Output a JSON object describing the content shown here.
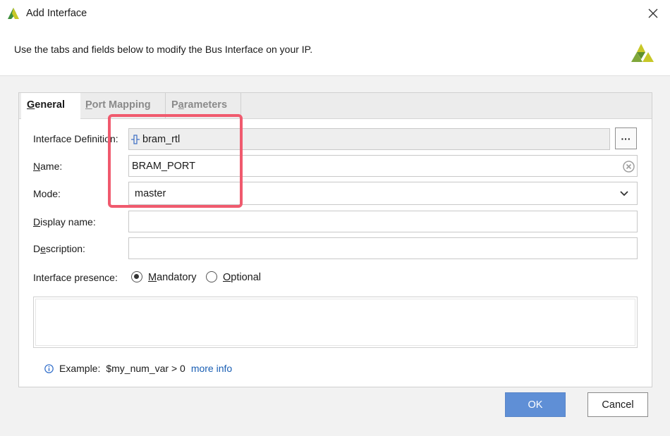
{
  "window": {
    "title": "Add Interface",
    "logo_icon": "vivado-logo-icon",
    "close_icon": "close-icon"
  },
  "header": {
    "description": "Use the tabs and fields below to modify the Bus Interface on your IP.",
    "brand_icon": "xilinx-logo-icon"
  },
  "tabs": [
    {
      "label": "General",
      "accel": "G",
      "rest": "eneral",
      "active": true
    },
    {
      "label": "Port Mapping",
      "accel": "P",
      "rest": "ort Mapping",
      "active": false
    },
    {
      "label": "Parameters",
      "pre": "P",
      "accel": "a",
      "rest": "rameters",
      "active": false
    }
  ],
  "form": {
    "interface_definition": {
      "label": "Interface Definition:",
      "value": "bram_rtl",
      "icon": "bus-interface-icon",
      "browse_label": "···"
    },
    "name": {
      "label_accel": "N",
      "label_rest": "ame:",
      "value": "BRAM_PORT",
      "clear_icon": "clear-icon"
    },
    "mode": {
      "label": "Mode:",
      "value": "master",
      "dropdown_icon": "chevron-down-icon"
    },
    "display_name": {
      "label_accel": "D",
      "label_rest": "isplay name:",
      "value": ""
    },
    "description": {
      "label_pre": "D",
      "label_accel": "e",
      "label_rest": "scription:",
      "value": ""
    },
    "presence": {
      "label": "Interface presence:",
      "options": [
        {
          "accel": "M",
          "rest": "andatory",
          "checked": true
        },
        {
          "accel": "O",
          "rest": "ptional",
          "checked": false
        }
      ]
    }
  },
  "info": {
    "icon": "info-icon",
    "example_label": "Example:",
    "example_value": "$my_num_var > 0",
    "link_text": "more info"
  },
  "buttons": {
    "ok": "OK",
    "cancel": "Cancel"
  },
  "colors": {
    "highlight": "#f05a6e",
    "ok_button": "#5f8fd6",
    "link": "#1a5fb4"
  }
}
